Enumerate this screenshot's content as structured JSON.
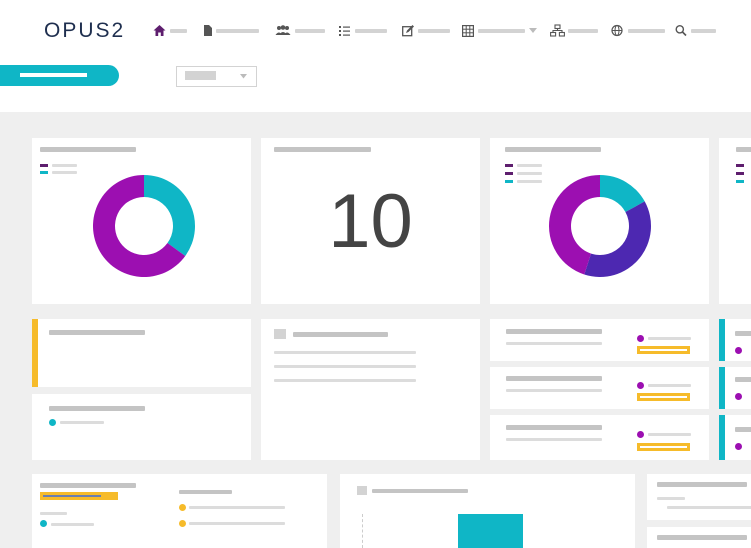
{
  "app": {
    "brand": "OPUS2"
  },
  "colors": {
    "purple_dark": "#5e1e6e",
    "purple": "#9c0fb1",
    "teal": "#0fb6c6",
    "violet": "#4d28b1",
    "yellow": "#f6bb2a",
    "nav_icon": "#555555"
  },
  "nav_icons": [
    "home-icon",
    "document-icon",
    "people-icon",
    "list-icon",
    "edit-icon",
    "grid-icon",
    "org-chart-icon",
    "globe-icon",
    "search-icon"
  ],
  "stat_widget": {
    "value": "10"
  },
  "chart_data": [
    {
      "type": "pie",
      "variant": "donut",
      "slices": [
        {
          "value": 35,
          "color": "#0fb6c6"
        },
        {
          "value": 65,
          "color": "#9c0fb1"
        }
      ]
    },
    {
      "type": "pie",
      "variant": "donut",
      "slices": [
        {
          "value": 17,
          "color": "#0fb6c6"
        },
        {
          "value": 38,
          "color": "#4d28b1"
        },
        {
          "value": 45,
          "color": "#9c0fb1"
        }
      ]
    }
  ]
}
